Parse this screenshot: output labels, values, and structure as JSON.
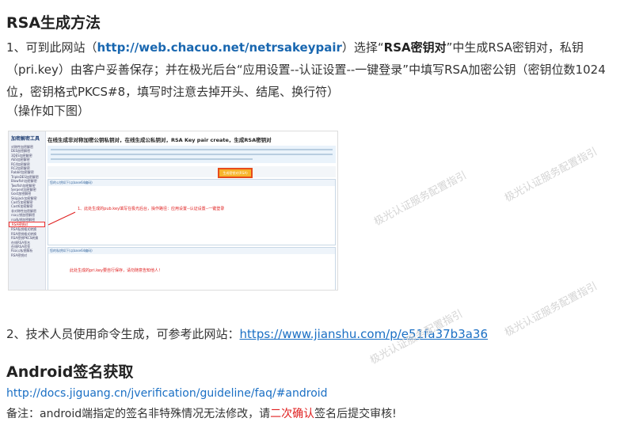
{
  "section1": {
    "heading": "RSA生成方法",
    "step1": {
      "prefix": "1、可到此网站（",
      "link": "http://web.chacuo.net/netrsakeypair",
      "mid1": "）选择“",
      "option": "RSA密钥对",
      "mid2": "”中生成RSA密钥对，私钥（pri.key）由客户妥善保存；并在极光后台“应用设置--认证设置--一键登录”中填写RSA加密公钥（密钥位数1024位，密钥格式PKCS#8，填写时注意去掉开头、结尾、换行符）",
      "note": "（操作如下图）"
    },
    "screenshot": {
      "page_title": "在线生成非对称加密公钥私钥对，在线生成公私钥对，RSA Key pair create，生成RSA密钥对",
      "sidebar_title": "加密解密工具",
      "sidebar_items": [
        "对称性加密解密",
        "DES加密解密",
        "3DES加密解密",
        "AES加密解密",
        "RC4加密解密",
        "RC2加密解密",
        "Rabbit加密解密",
        "TripleDES加密解密",
        "Blowfish加密解密",
        "Twofish加密解密",
        "Serpent加密解密",
        "Gost加密解密",
        "Skipjack加密解密",
        "Cast5加密解密",
        "Cast6加密解密",
        "非对称性加密解密",
        "rsa公钥加密解密",
        "rsa私钥加密解密",
        "RSA密钥对",
        "RSA私钥格式转换",
        "RSA密钥格式转换",
        "RSA密钥PKCS转换",
        "在线RSA签名",
        "在线RSA验签",
        "Rsa公私钥解析",
        "RSA密钥对"
      ],
      "selected_item": "RSA密钥对",
      "gen_button": "生成密钥对(RSA)",
      "public_key_label": "您的公钥如下(以base64编码)",
      "private_key_label": "您的私钥如下(以base64编码)",
      "annotation_public": "1、此处生成的pub.key填写在极光后台，操作路径：应用设置--认证设置--一键登录",
      "annotation_private": "此处生成的pri.key要自行保存，请勿随意告知他人！"
    },
    "step2": {
      "text": "2、技术人员使用命令生成，可参考此网站：",
      "link": "https://www.jianshu.com/p/e51fa37b3a36"
    }
  },
  "section2": {
    "heading": "Android签名获取",
    "link": "http://docs.jiguang.cn/jverification/guideline/faq/#android",
    "note_prefix": "备注：android端指定的签名非特殊情况无法修改，请",
    "note_emph": "二次确认",
    "note_suffix": "签名后提交审核!"
  },
  "watermarks": [
    "极光认证服务配置指引",
    "极光认证服务配置指引",
    "极光认证服务配置指引",
    "极光认证服务配置指引"
  ]
}
